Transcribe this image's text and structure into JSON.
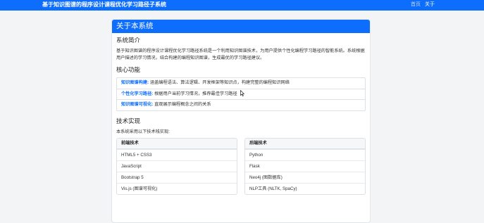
{
  "navbar": {
    "brand": "基于知识图谱的程序设计课程优化学习路径子系统",
    "links": [
      {
        "label": "首页",
        "active": false
      },
      {
        "label": "关于",
        "active": true
      }
    ]
  },
  "card": {
    "title": "关于本系统",
    "intro": {
      "heading": "系统简介",
      "text": "基于知识图谱的程序设计课程优化学习路径系统是一个利用知识图谱技术，为用户提供个性化编程学习路径的智能系统。系统根据用户描述的学习情况，结合构建的编程知识图谱，生成最优的学习路径建议。"
    },
    "features": {
      "heading": "核心功能",
      "items": [
        {
          "name": "知识图谱构建:",
          "desc": "涵盖编程语法、算法逻辑、开发框架等知识点，构建完整的编程知识网络"
        },
        {
          "name": "个性化学习路径:",
          "desc": "根据用户当前学习情况，推荐最佳学习路径"
        },
        {
          "name": "知识图谱可视化:",
          "desc": "直观展示编程概念之间的关系"
        }
      ]
    },
    "tech": {
      "heading": "技术实现",
      "intro": "本系统采用以下技术栈实现:",
      "frontend": {
        "title": "前端技术",
        "items": [
          "HTML5 + CSS3",
          "JavaScript",
          "Bootstrap 5",
          "Vis.js (图谱可视化)"
        ]
      },
      "backend": {
        "title": "后端技术",
        "items": [
          "Python",
          "Flask",
          "Neo4j (图数据库)",
          "NLP工具 (NLTK, SpaCy)"
        ]
      }
    }
  }
}
